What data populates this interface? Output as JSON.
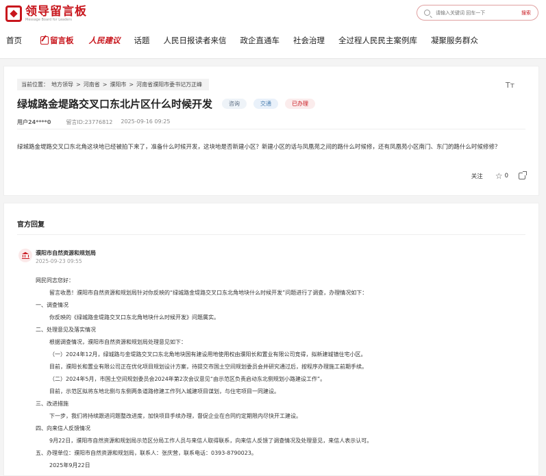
{
  "header": {
    "logo_cn": "领导留言板",
    "logo_en": "Message Board for Leaders",
    "search_placeholder": "请输入关键词 回车一下",
    "search_button": "搜索"
  },
  "nav": {
    "items": [
      "首页",
      "留言板",
      "人民建议",
      "话题",
      "人民日报读者来信",
      "政企直通车",
      "社会治理",
      "全过程人民民主案例库",
      "凝聚服务群众"
    ]
  },
  "message": {
    "breadcrumb": [
      "当前位置：",
      "地方领导",
      ">",
      "河南省",
      ">",
      "濮阳市",
      ">",
      "河南省濮阳市委书记万正峰"
    ],
    "font_icon": "Tт",
    "title": "绿城路金堤路交叉口东北片区什么时候开发",
    "tags": [
      "咨询",
      "交通",
      "已办理"
    ],
    "user": "用户24****0",
    "message_id": "留言ID:23776812",
    "date": "2025-09-16 09:25",
    "content": "绿城路金堤路交叉口东北角这块地已经被拍下来了，准备什么时候开发，这块地是否新建小区？新建小区的话与凤凰苑之间的路什么时候修，还有凤凰苑小区南门、东门的路什么时候修修？",
    "follow_label": "关注",
    "star_count": "0"
  },
  "reply": {
    "section_title": "官方回复",
    "org_name": "濮阳市自然资源和规划局",
    "date": "2025-09-23 09:55",
    "lines": [
      "网民同志您好：",
      "留言收悉！濮阳市自然资源和规划局针对你反映的“绿城路金堤路交叉口东北角地块什么时候开发”问题进行了调查，办理情况如下：",
      "一、调查情况",
      "你反映的《绿城路金堤路交叉口东北角地块什么时候开发》问题属实。",
      "二、处理意见及落实情况",
      "根据调查情况，濮阳市自然资源和规划局处理意见如下：",
      "（一）2024年12月，绿城路与金堤路交叉口东北角地块国有建设用地使用权由濮阳长和置业有限公司竞得，拟新建城镇住宅小区。",
      "目前，濮阳长和置业有限公司正在优化项目规划设计方案，待提交市国土空间规划委员会并研究通过后，按程序办理施工前期手续。",
      "（二）2024年5月，市国土空间规划委员会2024年第2次会议意见“由示范区负责启动东北侧规划小路建设工作”。",
      "目前，示范区拟将东地北侧与东侧两条道路修建工作列入城建项目谋划，与住宅项目一同建设。",
      "三、改进措施",
      "下一步，我们将持续跟进问题整改进度，加快项目手续办理，督促企业在合同约定期限内尽快开工建设。",
      "四、向来信人反馈情况",
      "9月22日，濮阳市自然资源和规划局示范区分局工作人员与来信人取得联系，向来信人反馈了调查情况及处理意见，来信人表示认可。",
      "五、办理单位：濮阳市自然资源和规划局，联系人：张庆营，联系电话：0393-8790023。",
      "2025年9月22日"
    ]
  }
}
